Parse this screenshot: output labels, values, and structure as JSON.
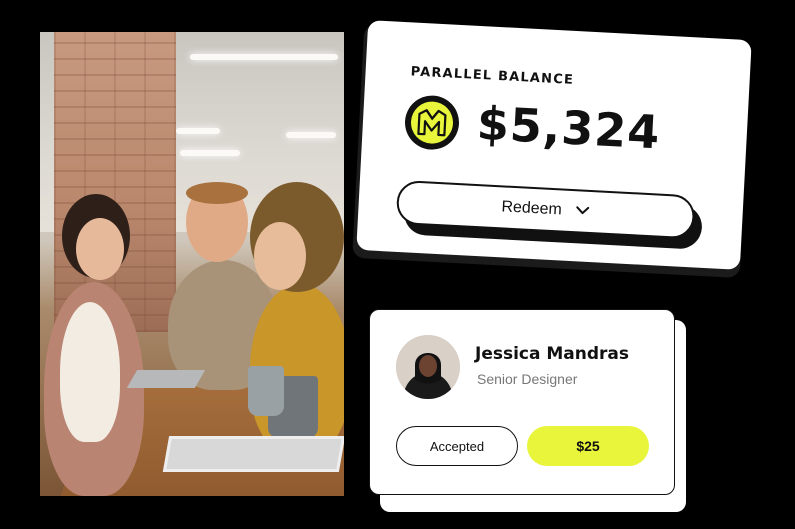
{
  "balance_card": {
    "title": "PARALLEL BALANCE",
    "amount": "$5,324",
    "coin_icon": "parallel-logo-icon",
    "redeem_label": "Redeem",
    "redeem_icon": "chevron-down-icon"
  },
  "profile_card": {
    "name": "Jessica Mandras",
    "role": "Senior Designer",
    "status_label": "Accepted",
    "amount_label": "$25"
  },
  "colors": {
    "accent": "#e8f53a",
    "text": "#111111",
    "muted": "#777777",
    "background": "#000000"
  }
}
